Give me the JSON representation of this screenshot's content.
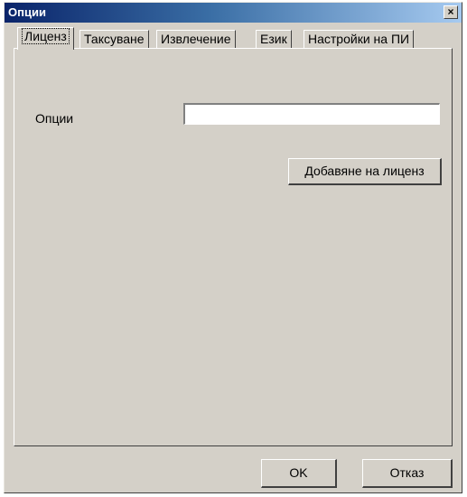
{
  "window": {
    "title": "Опции",
    "close_glyph": "×"
  },
  "tabs": [
    {
      "label": "Лиценз",
      "active": true
    },
    {
      "label": "Таксуване",
      "active": false
    },
    {
      "label": "Извлечение",
      "active": false
    },
    {
      "label": "Език",
      "active": false
    },
    {
      "label": "Настройки на ПИ",
      "active": false
    }
  ],
  "license_tab": {
    "options_label": "Опции",
    "options_value": "",
    "add_license_label": "Добавяне на лиценз"
  },
  "footer": {
    "ok_label": "OK",
    "cancel_label": "Отказ"
  },
  "colors": {
    "title_start": "#0a246a",
    "title_end": "#a6caf0",
    "face": "#d4d0c8"
  }
}
